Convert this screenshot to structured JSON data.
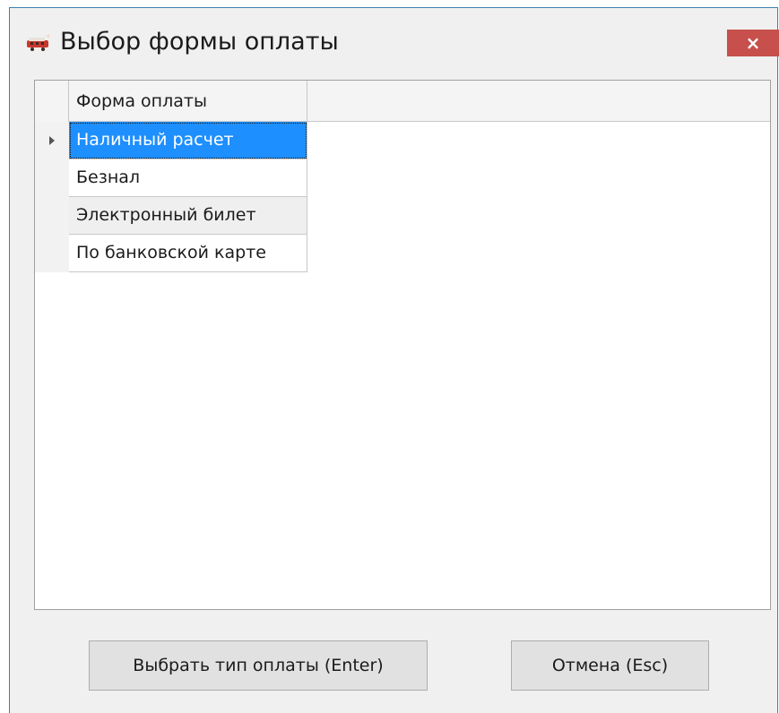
{
  "window": {
    "title": "Выбор формы оплаты",
    "close_label": "×",
    "app_icon": "train-icon"
  },
  "grid": {
    "column_header": "Форма оплаты",
    "rows": [
      {
        "label": "Наличный расчет",
        "selected": true
      },
      {
        "label": "Безнал",
        "selected": false
      },
      {
        "label": "Электронный билет",
        "selected": false
      },
      {
        "label": "По банковской карте",
        "selected": false
      }
    ]
  },
  "buttons": {
    "select_label": "Выбрать тип оплаты (Enter)",
    "cancel_label": "Отмена (Esc)"
  },
  "colors": {
    "selection": "#1e8fff",
    "close_button": "#c7504c",
    "window_border": "#3c7fb1"
  }
}
